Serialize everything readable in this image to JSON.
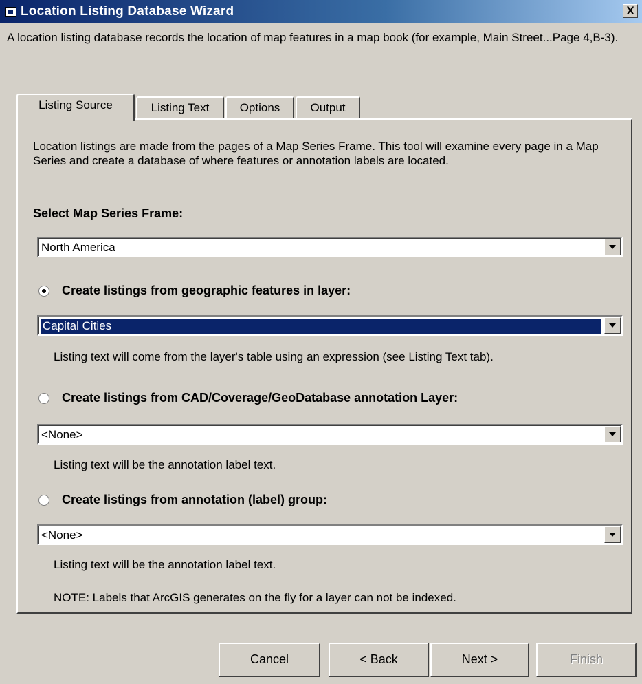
{
  "window": {
    "title": "Location Listing Database Wizard",
    "close_glyph": "X"
  },
  "intro": "A location listing database records the location of map features in a map book (for example, Main Street...Page 4,B-3).",
  "tabs": [
    {
      "label": "Listing Source",
      "active": true
    },
    {
      "label": "Listing Text",
      "active": false
    },
    {
      "label": "Options",
      "active": false
    },
    {
      "label": "Output",
      "active": false
    }
  ],
  "panel": {
    "description": "Location listings are made from the pages of a Map Series Frame.  This tool will examine every page in a Map Series and create a database of where features or annotation labels are located.",
    "select_label": "Select Map Series Frame:",
    "map_series_value": "North America",
    "option1": {
      "label": "Create listings from geographic features in layer:",
      "checked": true,
      "value": "Capital Cities",
      "hint": "Listing text will come from the layer's table using an expression (see Listing Text tab)."
    },
    "option2": {
      "label": "Create listings from CAD/Coverage/GeoDatabase annotation Layer:",
      "checked": false,
      "value": "<None>",
      "hint": "Listing text will be the annotation label text."
    },
    "option3": {
      "label": "Create listings from annotation (label) group:",
      "checked": false,
      "value": "<None>",
      "hint": "Listing text will be the annotation label text."
    },
    "note": "NOTE: Labels that ArcGIS generates on the fly for a layer can not be indexed."
  },
  "buttons": {
    "cancel": "Cancel",
    "back": "< Back",
    "next": "Next >",
    "finish": "Finish"
  },
  "colors": {
    "face": "#d4d0c8",
    "title_active": "#0a246a",
    "selection": "#0a246a"
  }
}
